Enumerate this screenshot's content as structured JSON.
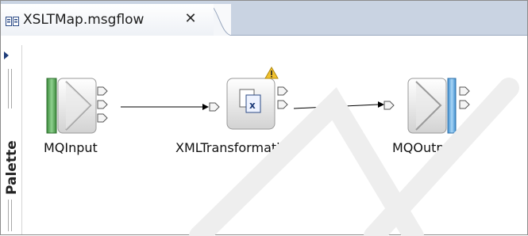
{
  "editor_tab": {
    "title": "XSLTMap.msgflow",
    "close_glyph": "✕",
    "icon": "msgflow-file-icon"
  },
  "palette": {
    "label": "Palette",
    "expand_icon": "triangle-right-icon"
  },
  "nodes": [
    {
      "id": "mqinput",
      "label": "MQInput",
      "icon": "mq-input-node-icon"
    },
    {
      "id": "xmltransformation",
      "label": "XMLTransformation",
      "icon": "xml-transformation-node-icon",
      "warning": true
    },
    {
      "id": "mqoutput",
      "label": "MQOutput",
      "icon": "mq-output-node-icon"
    }
  ],
  "connections": [
    {
      "from": "MQInput",
      "to": "XMLTransformation"
    },
    {
      "from": "XMLTransformation",
      "to": "MQOutput"
    }
  ],
  "colors": {
    "tab_strip": "#c9d3e2",
    "input_bar": "#5aa85a",
    "output_bar": "#6aaee0",
    "warning": "#f2c22e"
  }
}
